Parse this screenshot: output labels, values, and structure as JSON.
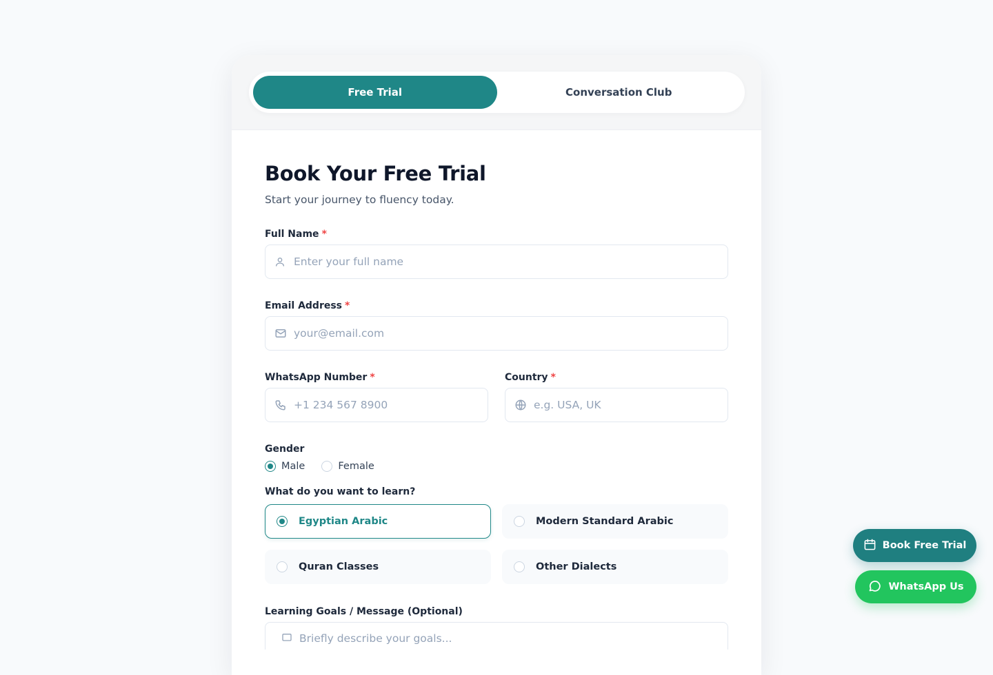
{
  "tabs": [
    {
      "label": "Free Trial",
      "active": true
    },
    {
      "label": "Conversation Club",
      "active": false
    }
  ],
  "form": {
    "title": "Book Your Free Trial",
    "subtitle": "Start your journey to fluency today.",
    "required_mark": "*",
    "full_name": {
      "label": "Full Name",
      "placeholder": "Enter your full name",
      "icon": "user-icon"
    },
    "email": {
      "label": "Email Address",
      "placeholder": "your@email.com",
      "icon": "mail-icon"
    },
    "whatsapp": {
      "label": "WhatsApp Number",
      "placeholder": "+1 234 567 8900",
      "icon": "phone-icon"
    },
    "country": {
      "label": "Country",
      "placeholder": "e.g. USA, UK",
      "icon": "globe-icon"
    },
    "gender": {
      "label": "Gender",
      "options": [
        "Male",
        "Female"
      ],
      "selected": "Male"
    },
    "learn": {
      "label": "What do you want to learn?",
      "options": [
        "Egyptian Arabic",
        "Modern Standard Arabic",
        "Quran Classes",
        "Other Dialects"
      ],
      "selected": "Egyptian Arabic"
    },
    "goals": {
      "label": "Learning Goals / Message (Optional)",
      "placeholder": "Briefly describe your goals...",
      "icon": "message-icon"
    }
  },
  "floating": {
    "book_label": "Book Free Trial",
    "book_icon": "calendar-icon",
    "whatsapp_label": "WhatsApp Us",
    "whatsapp_icon": "chat-bubble-icon"
  },
  "colors": {
    "accent": "#1f8787",
    "whatsapp": "#22c55e",
    "required": "#ef4444"
  }
}
